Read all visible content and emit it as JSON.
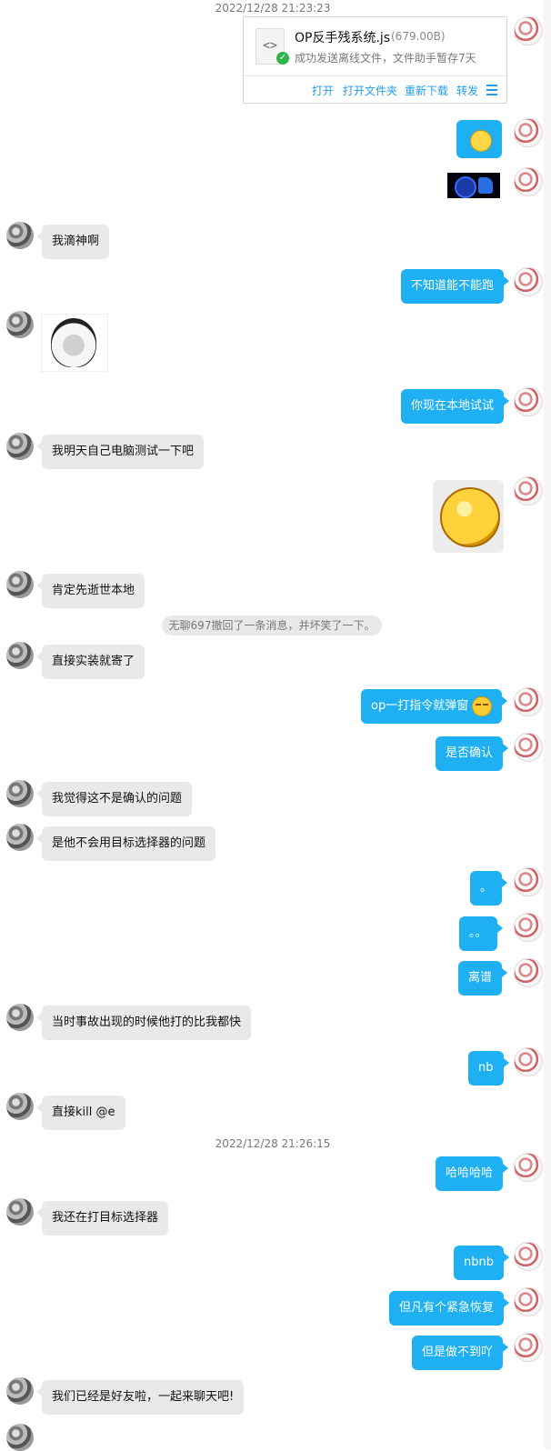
{
  "timestamps": [
    "2022/12/28 21:23:23",
    "2022/12/28 21:26:15"
  ],
  "file": {
    "name": "OP反手残系统.js",
    "size": "(679.00B)",
    "status": "成功发送离线文件，文件助手暂存7天",
    "actions": [
      "打开",
      "打开文件夹",
      "重新下载",
      "转发"
    ],
    "icon": "code-file-icon"
  },
  "recall_notice": "无聊697撤回了一条消息，并坏笑了一下。",
  "messages": {
    "m1": "我滴神啊",
    "m2": "不知道能不能跑",
    "m3": "你现在本地试试",
    "m4": "我明天自己电脑测试一下吧",
    "m5": "肯定先逝世本地",
    "m6": "直接实装就寄了",
    "m7": "op一打指令就弹窗",
    "m8": "是否确认",
    "m9": "我觉得这不是确认的问题",
    "m10": "是他不会用目标选择器的问题",
    "m11": "。",
    "m12": "。。",
    "m13": "离谱",
    "m14": "当时事故出现的时候他打的比我都快",
    "m15": "nb",
    "m16": "直接kill @e",
    "m17": "哈哈哈哈",
    "m18": "我还在打目标选择器",
    "m19": "nbnb",
    "m20": "但凡有个紧急恢复",
    "m21": "但是做不到吖",
    "m22": "我们已经是好友啦，一起来聊天吧!"
  },
  "colors": {
    "outgoing_bubble": "#1eb0f2",
    "incoming_bubble": "#e9e9e9",
    "link": "#1e9cf0"
  }
}
